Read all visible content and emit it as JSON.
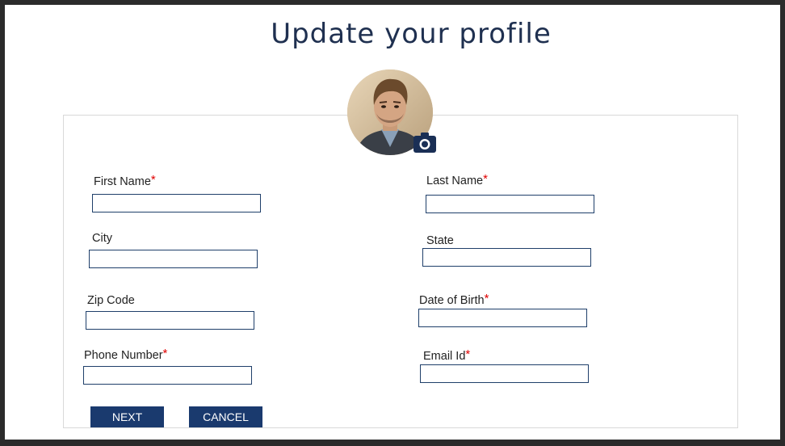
{
  "page": {
    "title": "Update your profile"
  },
  "avatar": {
    "icon": "camera-icon"
  },
  "form": {
    "first_name": {
      "label": "First Name",
      "required_mark": "*",
      "value": ""
    },
    "last_name": {
      "label": "Last Name",
      "required_mark": "*",
      "value": ""
    },
    "city": {
      "label": "City",
      "value": ""
    },
    "state": {
      "label": "State",
      "value": ""
    },
    "zip_code": {
      "label": "Zip Code",
      "value": ""
    },
    "date_of_birth": {
      "label": "Date of Birth",
      "required_mark": "*",
      "value": ""
    },
    "phone_number": {
      "label": "Phone Number",
      "required_mark": "*",
      "value": ""
    },
    "email_id": {
      "label": "Email Id",
      "required_mark": "*",
      "value": ""
    }
  },
  "buttons": {
    "next": "NEXT",
    "cancel": "CANCEL"
  },
  "colors": {
    "brand": "#1a3a6e",
    "title": "#1f3050",
    "required": "#e00000"
  }
}
